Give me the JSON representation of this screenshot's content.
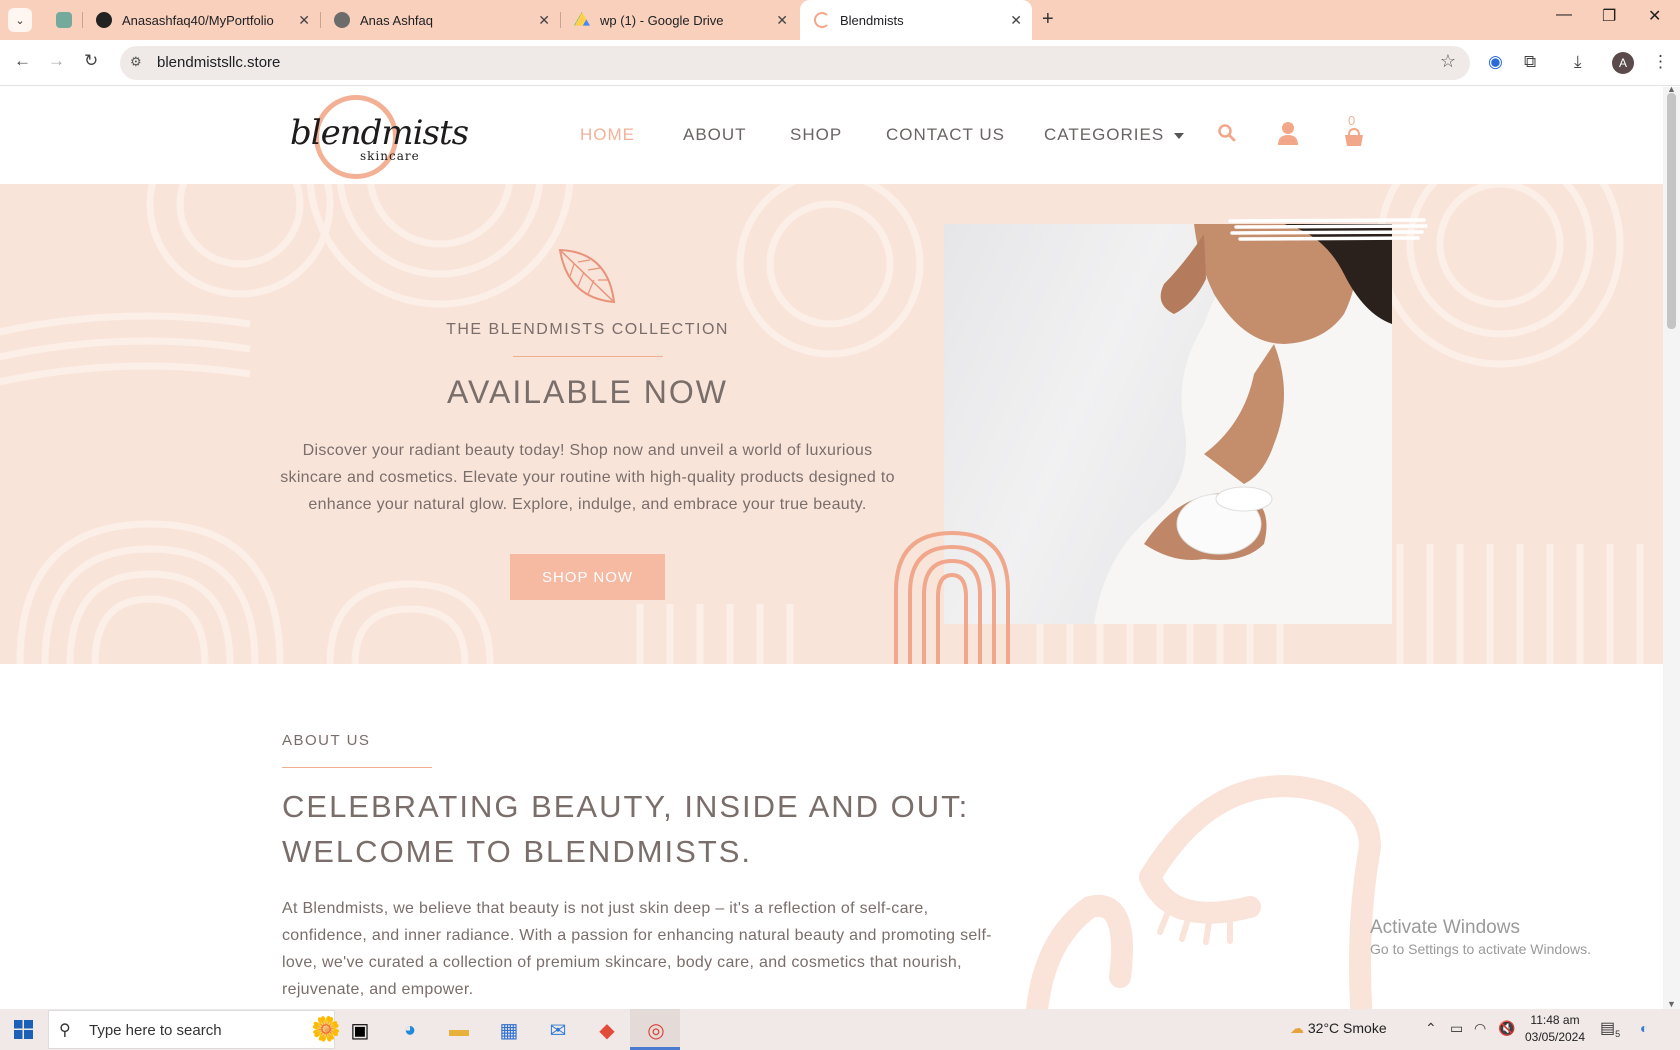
{
  "browser": {
    "tabs": [
      {
        "title": "",
        "type": "chatgpt"
      },
      {
        "title": "Anasashfaq40/MyPortfolio",
        "type": "github"
      },
      {
        "title": "Anas Ashfaq",
        "type": "globe"
      },
      {
        "title": "wp (1) - Google Drive",
        "type": "drive"
      },
      {
        "title": "Blendmists",
        "type": "loading",
        "active": true
      }
    ],
    "url": "blendmistsllc.store",
    "profile_initial": "A",
    "accent_color": "#f9d0bc"
  },
  "site": {
    "logo_word": "blendmists",
    "logo_sub": "skincare",
    "nav": [
      {
        "label": "HOME",
        "active": true
      },
      {
        "label": "ABOUT"
      },
      {
        "label": "SHOP"
      },
      {
        "label": "CONTACT US"
      },
      {
        "label": "CATEGORIES",
        "has_dropdown": true
      }
    ],
    "cart_count": "0",
    "brand_color": "#f6b9a2"
  },
  "hero": {
    "eyebrow": "THE BLENDMISTS COLLECTION",
    "title": "AVAILABLE NOW",
    "description": "Discover your radiant beauty today! Shop now and unveil a world of luxurious skincare and cosmetics. Elevate your routine with high-quality products designed to enhance your natural glow. Explore, indulge, and embrace your true beauty.",
    "button": "SHOP NOW"
  },
  "about": {
    "eyebrow": "ABOUT US",
    "title": "CELEBRATING BEAUTY, INSIDE AND OUT: WELCOME TO BLENDMISTS.",
    "text": "At Blendmists, we believe that beauty is not just skin deep – it's a reflection of self-care, confidence, and inner radiance. With a passion for enhancing natural beauty and promoting self-love, we've curated a collection of premium skincare, body care, and cosmetics that nourish, rejuvenate, and empower."
  },
  "watermark": {
    "line1": "Activate Windows",
    "line2": "Go to Settings to activate Windows."
  },
  "taskbar": {
    "search_placeholder": "Type here to search",
    "weather": "32°C  Smoke",
    "time": "11:48 am",
    "date": "03/05/2024",
    "notifications": "5"
  }
}
